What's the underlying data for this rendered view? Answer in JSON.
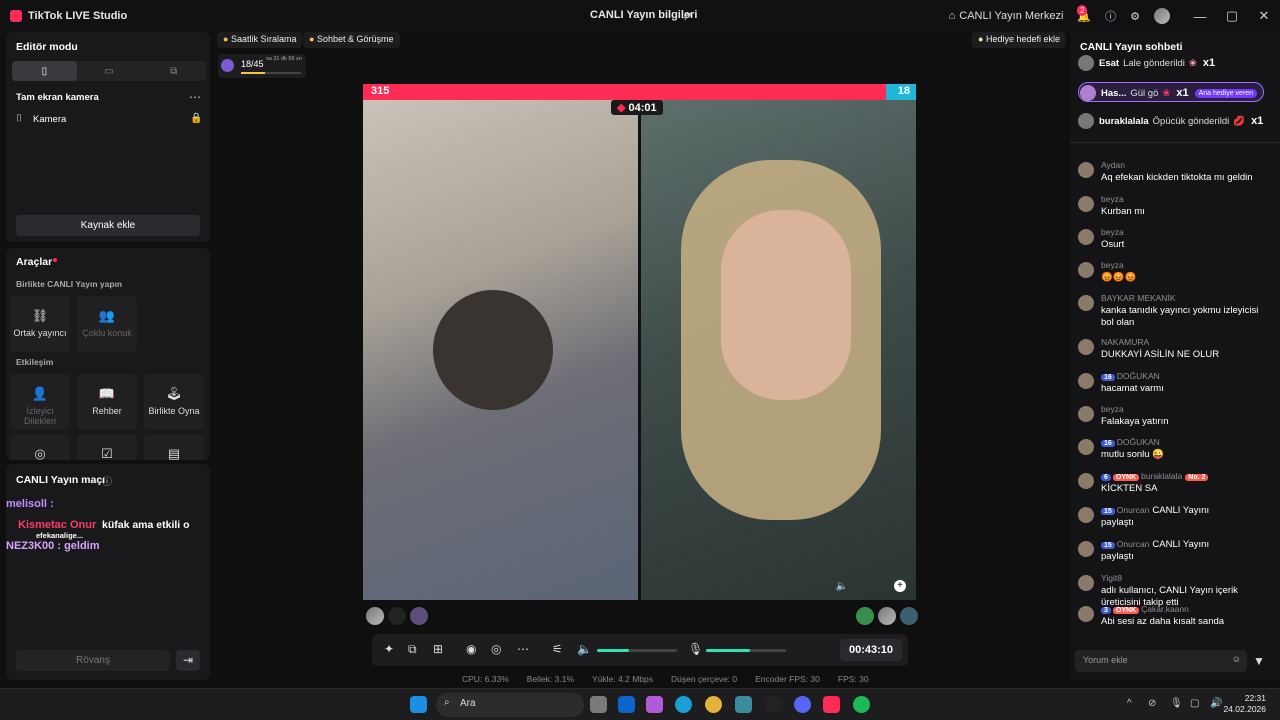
{
  "app": {
    "name": "TikTok LIVE Studio",
    "title": "CANLI Yayın bilgileri",
    "center": "CANLI Yayın Merkezi",
    "notif_count": "2"
  },
  "left": {
    "editor_mode": "Editör modu",
    "fullscreen_camera": "Tam ekran kamera",
    "camera": "Kamera",
    "add_source": "Kaynak ekle",
    "tools_title": "Araçlar",
    "live_together": "Birlikte CANLI Yayın yapın",
    "co_host": "Ortak yayıncı",
    "multi_guest": "Çoklu konuk",
    "interaction": "Etkileşim",
    "viewer_wishes": "İzleyici Dilekleri",
    "guide": "Rehber",
    "play_together": "Birlikte Oyna",
    "live_match": "CANLI Yayın maçı",
    "rematch": "Rövanş",
    "overlay": {
      "l1": "melisoll :",
      "l2": "Kismetac Onur",
      "l3": "NEZ3K00 : geldim",
      "l4": "küfak ama etkili o",
      "l5": "efekanalige..."
    }
  },
  "top_chips": {
    "hourly": "Saatlik Sıralama",
    "chat_meet": "Sohbet & Görüşme",
    "goal": "Hediye hedefi ekle",
    "progress": "18/45",
    "progress_sub": "sa 31 dk 59 sn",
    "progress_value": 0.4
  },
  "stream": {
    "left_score": "315",
    "right_score": "18",
    "timer": "04:01",
    "left_share": 0.945
  },
  "controls": {
    "elapsed": "00:43:10",
    "speaker_level": 0.4,
    "mic_level": 0.55
  },
  "stats": {
    "cpu": "CPU:  6.33%",
    "mem": "Bellek:  3.1%",
    "upload": "Yükle:  4.2 Mbps",
    "dropped": "Düşen çerçeve:  0",
    "enc_fps": "Encoder FPS:  30",
    "fps": "FPS:  30"
  },
  "chat": {
    "title": "CANLI Yayın sohbeti",
    "gifts": [
      {
        "name": "Esat",
        "text": "Lale gönderildi",
        "count": "x1"
      },
      {
        "name": "Has...",
        "text": "Gül gö",
        "count": "x1",
        "tag": "Ana hediye veren"
      },
      {
        "name": "buraklalala",
        "text": "Öpücük gönderildi",
        "count": "x1"
      }
    ],
    "messages": [
      {
        "name": "Aydan",
        "text": "Aq efekan kickden tiktokta mı geldin"
      },
      {
        "name": "beyza",
        "text": "Kurban mı"
      },
      {
        "name": "beyza",
        "text": "Osurt"
      },
      {
        "name": "beyza",
        "text": "😡😡😡"
      },
      {
        "name": "BAYKAR MEKANİK",
        "text": "kanka tanıdık yayıncı yokmu izleyicisi bol olan"
      },
      {
        "name": "NAKAMURA",
        "text": "DUKKAYİ ASİLİN NE OLUR"
      },
      {
        "name": "DOĞUKAN",
        "text": "hacamat varmı",
        "lvl": "16"
      },
      {
        "name": "beyza",
        "text": "Falakaya yatırın"
      },
      {
        "name": "DOĞUKAN",
        "text": "mutlu sonlu 😜",
        "lvl": "16"
      },
      {
        "name": "buraklalala",
        "text": "KİCKTEN SA",
        "lvl": "6",
        "oynk": "OYNK",
        "no": "No. 2"
      },
      {
        "name": "Onurcan",
        "text": "paylaştı",
        "lvl": "15",
        "extra": "CANLI Yayını"
      },
      {
        "name": "Onurcan",
        "text": "paylaştı",
        "lvl": "15",
        "extra": "CANLI Yayını"
      },
      {
        "name": "Yigit8",
        "text": "adlı kullanıcı, CANLI Yayın içerik üreticisini takip etti"
      },
      {
        "name": "Çakar.kaann",
        "text": "Abi sesi az daha kısalt sanda",
        "lvl": "3",
        "oynk": "OYNK"
      }
    ],
    "input_placeholder": "Yorum ekle"
  },
  "taskbar": {
    "search": "Ara",
    "time": "22:31",
    "date": "24.02.2026"
  }
}
